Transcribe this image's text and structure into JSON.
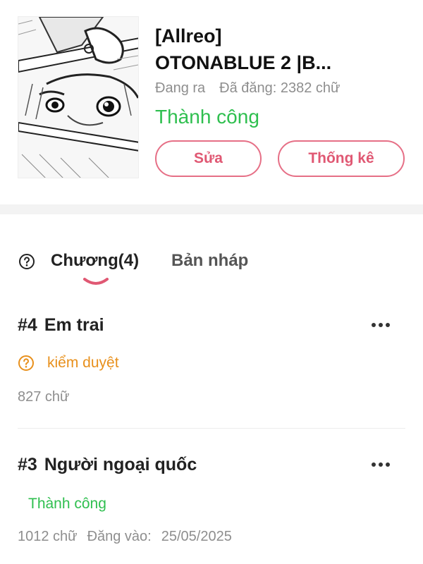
{
  "story": {
    "title_line1": "[Allreo]",
    "title_line2": "OTONABLUE 2 |B...",
    "state": "Đang ra",
    "published_words": "Đã đăng: 2382 chữ",
    "status": "Thành công",
    "edit_label": "Sửa",
    "stats_label": "Thống kê"
  },
  "tabs": {
    "chapters_label": "Chương(4)",
    "drafts_label": "Bản nháp"
  },
  "chapters": [
    {
      "number": "#4",
      "title": "Em trai",
      "status": "kiểm duyệt",
      "words": "827 chữ"
    },
    {
      "number": "#3",
      "title": "Người ngoại quốc",
      "status": "Thành công",
      "words": "1012 chữ",
      "published_label": "Đăng vào:",
      "published_date": "25/05/2025"
    }
  ],
  "colors": {
    "accent": "#e05873",
    "success": "#2fbf4f",
    "warning": "#e8901c",
    "muted": "#8e8e8e"
  },
  "icons": {
    "help": "question-circle-icon",
    "more": "more-horizontal-icon",
    "warn": "question-circle-icon"
  }
}
